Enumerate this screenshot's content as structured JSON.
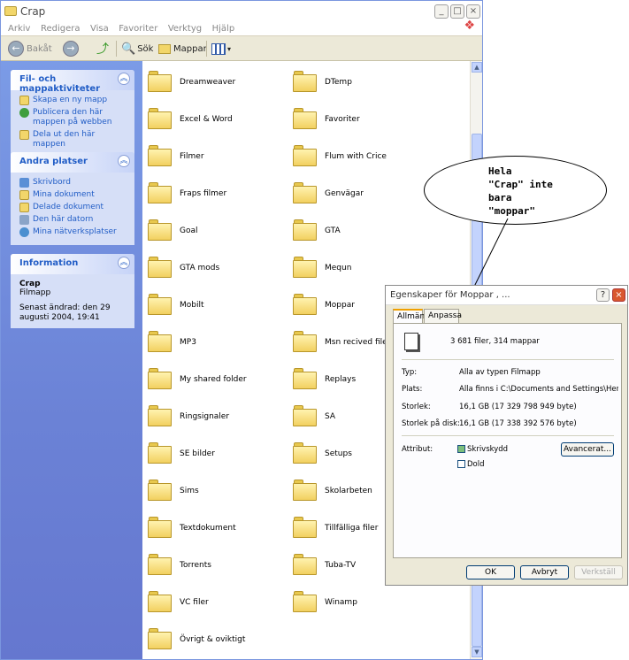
{
  "explorer": {
    "title": "Crap",
    "menu": [
      "Arkiv",
      "Redigera",
      "Visa",
      "Favoriter",
      "Verktyg",
      "Hjälp"
    ],
    "toolbar": {
      "back": "Bakåt",
      "search": "Sök",
      "folders": "Mappar"
    }
  },
  "taskpane": {
    "tasks": {
      "header": "Fil- och mappaktiviteter",
      "items": [
        "Skapa en ny mapp",
        "Publicera den här mappen på webben",
        "Dela ut den här mappen"
      ]
    },
    "places": {
      "header": "Andra platser",
      "items": [
        "Skrivbord",
        "Mina dokument",
        "Delade dokument",
        "Den här datorn",
        "Mina nätverksplatser"
      ]
    },
    "info": {
      "header": "Information",
      "name": "Crap",
      "type": "Filmapp",
      "modified": "Senast ändrad: den 29 augusti 2004, 19:41"
    }
  },
  "folders_left": [
    "Dreamweaver",
    "Excel & Word",
    "Filmer",
    "Fraps filmer",
    "Goal",
    "GTA mods",
    "Mobilt",
    "MP3",
    "My shared folder",
    "Ringsignaler",
    "SE bilder",
    "Sims",
    "Textdokument",
    "Torrents",
    "VC filer",
    "Övrigt & oviktigt"
  ],
  "folders_right": [
    "DTemp",
    "Favoriter",
    "Flum with Crice",
    "Genvägar",
    "GTA",
    "Mequn",
    "Moppar",
    "Msn recived files",
    "Replays",
    "SA",
    "Setups",
    "Skolarbeten",
    "Tillfälliga filer",
    "Tuba-TV",
    "Winamp"
  ],
  "callout": {
    "text": "Hela\n\"Crap\" inte\nbara\n\"moppar\""
  },
  "dialog": {
    "title": "Egenskaper för Moppar , ...",
    "tabs": [
      "Allmänt",
      "Anpassa"
    ],
    "summary": "3 681 filer, 314 mappar",
    "labels": {
      "type": "Typ:",
      "location": "Plats:",
      "size": "Storlek:",
      "size_on_disk": "Storlek på disk:",
      "attributes": "Attribut:"
    },
    "values": {
      "type": "Alla av typen Filmapp",
      "location": "Alla finns i C:\\Documents and Settings\\Henke.FL",
      "size": "16,1 GB (17 329 798 949 byte)",
      "size_on_disk": "16,1 GB (17 338 392 576 byte)"
    },
    "attributes": {
      "readonly": "Skrivskydd",
      "hidden": "Dold",
      "advanced": "Avancerat..."
    },
    "buttons": {
      "ok": "OK",
      "cancel": "Avbryt",
      "apply": "Verkställ"
    }
  }
}
